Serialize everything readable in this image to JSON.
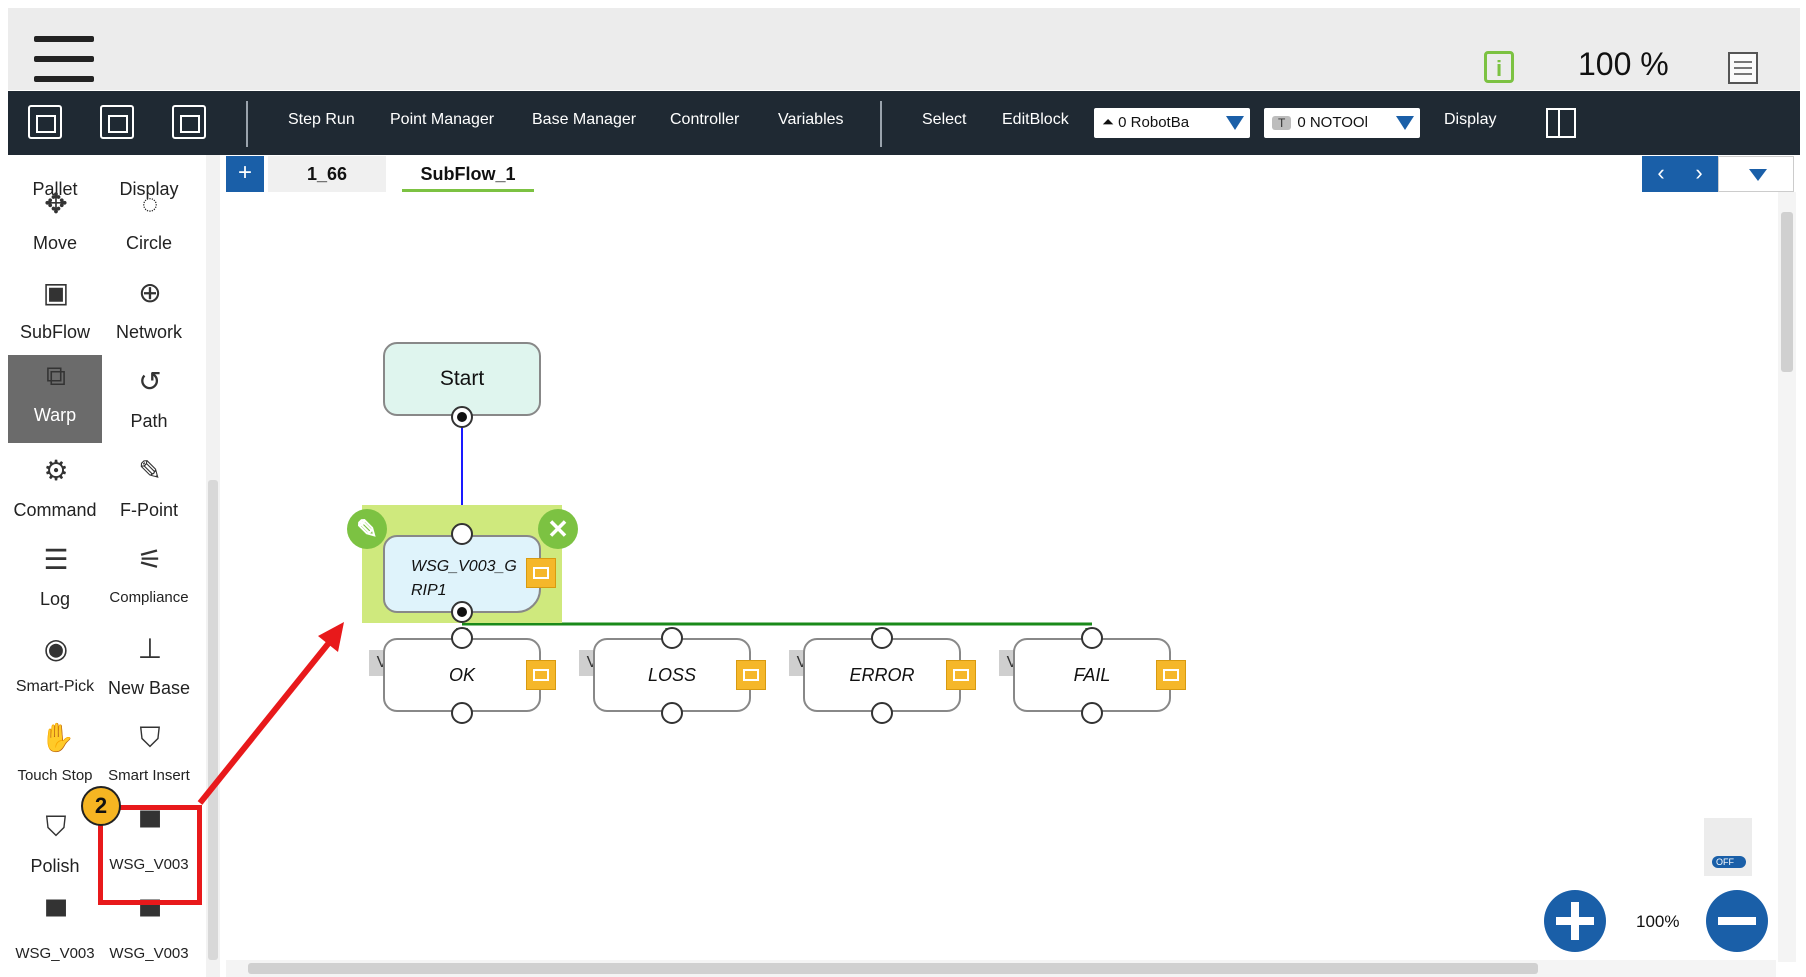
{
  "header": {
    "info_icon_letter": "i",
    "speed": "100 %"
  },
  "toolbar": {
    "buttons": [
      "Step Run",
      "Point Manager",
      "Base Manager",
      "Controller",
      "Variables",
      "Select",
      "EditBlock",
      "Display"
    ],
    "base_select": "0 RobotBa",
    "tool_select_tag": "T",
    "tool_select": "0 NOTOOl"
  },
  "sidebar": {
    "items": [
      {
        "label": "Pallet",
        "icon": "pallet-icon"
      },
      {
        "label": "Display",
        "icon": "display-icon"
      },
      {
        "label": "Move",
        "icon": "move-icon"
      },
      {
        "label": "Circle",
        "icon": "circle-icon"
      },
      {
        "label": "SubFlow",
        "icon": "subflow-icon"
      },
      {
        "label": "Network",
        "icon": "network-icon"
      },
      {
        "label": "Warp",
        "icon": "warp-icon",
        "active": true
      },
      {
        "label": "Path",
        "icon": "path-icon"
      },
      {
        "label": "Command",
        "icon": "command-icon"
      },
      {
        "label": "F-Point",
        "icon": "f-point-icon"
      },
      {
        "label": "Log",
        "icon": "log-icon"
      },
      {
        "label": "Compliance",
        "icon": "compliance-icon"
      },
      {
        "label": "Smart-Pick",
        "icon": "camera-icon"
      },
      {
        "label": "New Base",
        "icon": "new-base-icon"
      },
      {
        "label": "Touch Stop",
        "icon": "touch-stop-icon"
      },
      {
        "label": "Smart Insert",
        "icon": "smart-insert-icon"
      },
      {
        "label": "Polish",
        "icon": "polish-icon"
      },
      {
        "label": "WSG_V003",
        "icon": "gripper-icon"
      },
      {
        "label": "WSG_V003",
        "icon": "gripper-icon"
      },
      {
        "label": "WSG_V003",
        "icon": "gripper-settings-icon"
      }
    ]
  },
  "tabs": {
    "add": "+",
    "items": [
      "1_66",
      "SubFlow_1"
    ],
    "active": "SubFlow_1",
    "prev": "‹",
    "next": "›"
  },
  "flow": {
    "start_label": "Start",
    "wsg_label_line1": "WSG_V003_G",
    "wsg_label_line2": "RIP1",
    "outputs": [
      "OK",
      "LOSS",
      "ERROR",
      "FAIL"
    ],
    "output_tag": "V"
  },
  "zoom": {
    "level": "100%",
    "toggle_state": "OFF"
  },
  "annotation": {
    "step_number": "2",
    "highlight_color": "#e8191b"
  },
  "colors": {
    "toolbar_bg": "#1f2933",
    "accent_blue": "#1a5fa8",
    "accent_green": "#7cc242",
    "start_fill": "#dff5ee",
    "node_fill": "#dff3fb"
  }
}
